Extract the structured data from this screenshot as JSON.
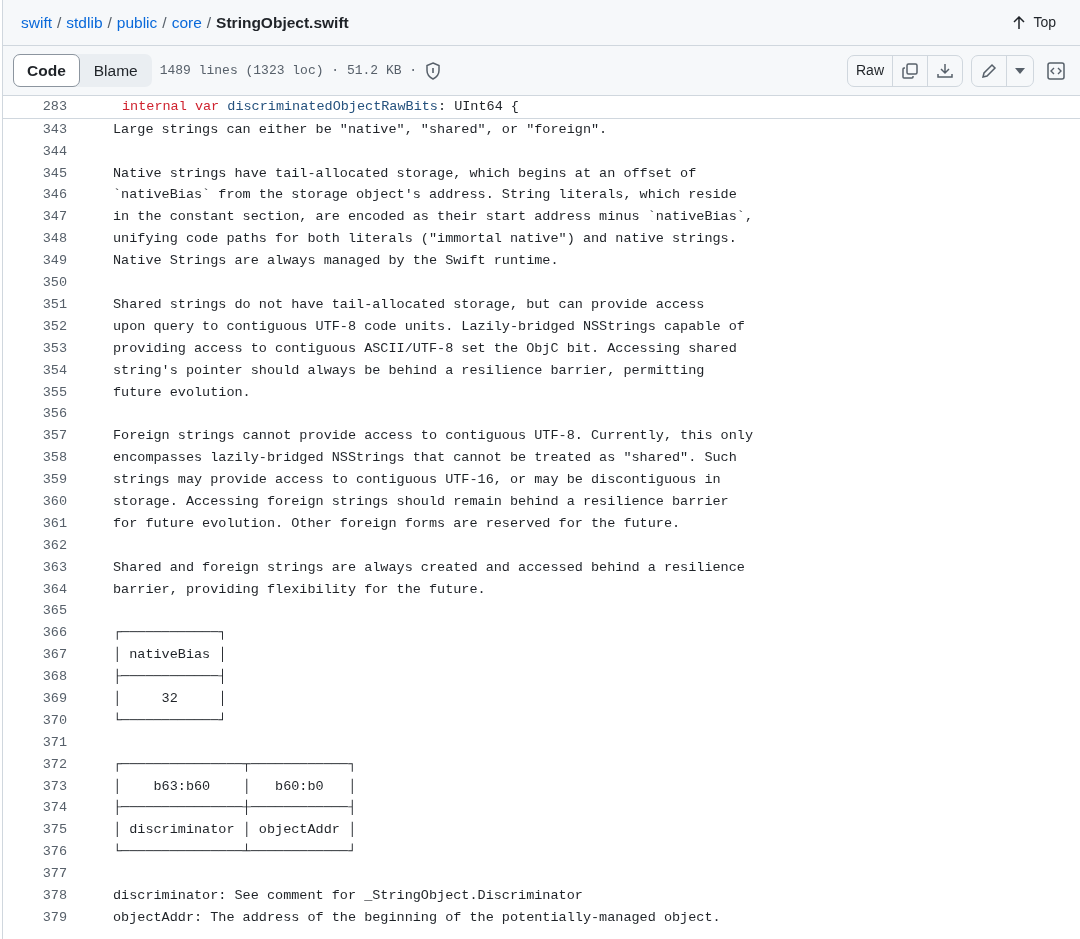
{
  "breadcrumb": [
    {
      "text": "swift",
      "kind": "link"
    },
    {
      "text": "stdlib",
      "kind": "link"
    },
    {
      "text": "public",
      "kind": "link"
    },
    {
      "text": "core",
      "kind": "link"
    },
    {
      "text": "StringObject.swift",
      "kind": "current"
    }
  ],
  "breadcrumb_separator": "/",
  "top_link": "Top",
  "view_tabs": [
    {
      "label": "Code",
      "selected": true
    },
    {
      "label": "Blame",
      "selected": false
    }
  ],
  "file_info": "1489 lines (1323 loc) · 51.2 KB ·",
  "raw_button": "Raw",
  "sticky_line": {
    "number": "283",
    "tokens": [
      {
        "text": "internal var",
        "kind": "keyword"
      },
      {
        "text": "discriminatedObjectRawBits",
        "kind": "name"
      },
      {
        "text": ": UInt64 {",
        "kind": "plain"
      }
    ]
  },
  "lines": [
    {
      "number": "343",
      "text": "Large strings can either be \"native\", \"shared\", or \"foreign\"."
    },
    {
      "number": "344"
    },
    {
      "number": "345",
      "text": "Native strings have tail-allocated storage, which begins at an offset of"
    },
    {
      "number": "346",
      "text": "`nativeBias` from the storage object's address. String literals, which reside"
    },
    {
      "number": "347",
      "text": "in the constant section, are encoded as their start address minus `nativeBias`,"
    },
    {
      "number": "348",
      "text": "unifying code paths for both literals (\"immortal native\") and native strings."
    },
    {
      "number": "349",
      "text": "Native Strings are always managed by the Swift runtime."
    },
    {
      "number": "350"
    },
    {
      "number": "351",
      "text": "Shared strings do not have tail-allocated storage, but can provide access"
    },
    {
      "number": "352",
      "text": "upon query to contiguous UTF-8 code units. Lazily-bridged NSStrings capable of"
    },
    {
      "number": "353",
      "text": "providing access to contiguous ASCII/UTF-8 set the ObjC bit. Accessing shared"
    },
    {
      "number": "354",
      "text": "string's pointer should always be behind a resilience barrier, permitting"
    },
    {
      "number": "355",
      "text": "future evolution."
    },
    {
      "number": "356"
    },
    {
      "number": "357",
      "text": "Foreign strings cannot provide access to contiguous UTF-8. Currently, this only"
    },
    {
      "number": "358",
      "text": "encompasses lazily-bridged NSStrings that cannot be treated as \"shared\". Such"
    },
    {
      "number": "359",
      "text": "strings may provide access to contiguous UTF-16, or may be discontiguous in"
    },
    {
      "number": "360",
      "text": "storage. Accessing foreign strings should remain behind a resilience barrier"
    },
    {
      "number": "361",
      "text": "for future evolution. Other foreign forms are reserved for the future."
    },
    {
      "number": "362"
    },
    {
      "number": "363",
      "text": "Shared and foreign strings are always created and accessed behind a resilience"
    },
    {
      "number": "364",
      "text": "barrier, providing flexibility for the future."
    },
    {
      "number": "365"
    },
    {
      "number": "366",
      "text": "┌────────────┐"
    },
    {
      "number": "367",
      "text": "│ nativeBias │"
    },
    {
      "number": "368",
      "text": "├────────────┤"
    },
    {
      "number": "369",
      "text": "│     32     │"
    },
    {
      "number": "370",
      "text": "└────────────┘"
    },
    {
      "number": "371"
    },
    {
      "number": "372",
      "text": "┌───────────────┬────────────┐"
    },
    {
      "number": "373",
      "text": "│    b63:b60    │   b60:b0   │"
    },
    {
      "number": "374",
      "text": "├───────────────┼────────────┤"
    },
    {
      "number": "375",
      "text": "│ discriminator │ objectAddr │"
    },
    {
      "number": "376",
      "text": "└───────────────┴────────────┘"
    },
    {
      "number": "377"
    },
    {
      "number": "378",
      "text": "discriminator: See comment for _StringObject.Discriminator"
    },
    {
      "number": "379",
      "text": "objectAddr: The address of the beginning of the potentially-managed object."
    }
  ]
}
